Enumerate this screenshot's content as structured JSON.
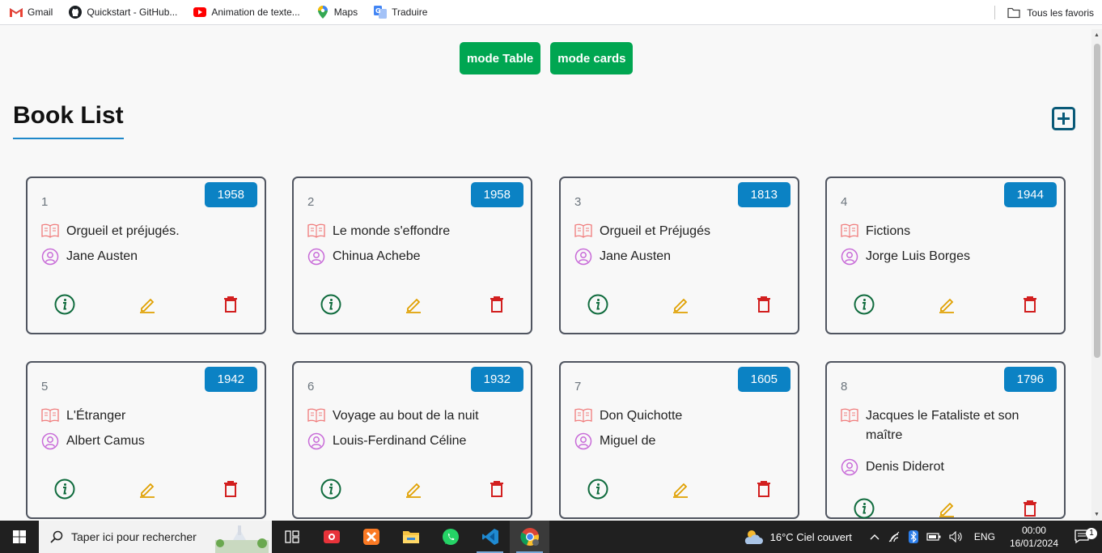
{
  "bookmarks": [
    {
      "label": "Gmail",
      "icon": "gmail-icon"
    },
    {
      "label": "Quickstart - GitHub...",
      "icon": "github-icon"
    },
    {
      "label": "Animation de texte...",
      "icon": "youtube-icon"
    },
    {
      "label": "Maps",
      "icon": "maps-icon"
    },
    {
      "label": "Traduire",
      "icon": "translate-icon"
    }
  ],
  "all_bookmarks": "Tous les favoris",
  "buttons": {
    "table": "mode Table",
    "cards": "mode cards"
  },
  "title": "Book List",
  "books": [
    {
      "id": "1",
      "year": "1958",
      "title": "Orgueil et préjugés.",
      "author": "Jane Austen"
    },
    {
      "id": "2",
      "year": "1958",
      "title": "Le monde s'effondre",
      "author": "Chinua Achebe"
    },
    {
      "id": "3",
      "year": "1813",
      "title": "Orgueil et Préjugés",
      "author": "Jane Austen"
    },
    {
      "id": "4",
      "year": "1944",
      "title": "Fictions",
      "author": "Jorge Luis Borges"
    },
    {
      "id": "5",
      "year": "1942",
      "title": "L'Étranger",
      "author": "Albert Camus"
    },
    {
      "id": "6",
      "year": "1932",
      "title": "Voyage au bout de la nuit",
      "author": "Louis-Ferdinand Céline"
    },
    {
      "id": "7",
      "year": "1605",
      "title": "Don Quichotte",
      "author": "Miguel de"
    },
    {
      "id": "8",
      "year": "1796",
      "title": "Jacques le Fataliste et son maître",
      "author": "Denis Diderot"
    }
  ],
  "colors": {
    "green": "#00a651",
    "blue": "#0b82c4",
    "info": "#0f6b3d",
    "edit": "#e0a000",
    "delete": "#d21f1f",
    "book": "#f07a7a",
    "user": "#c86bd8"
  },
  "taskbar": {
    "search_placeholder": "Taper ici pour rechercher",
    "weather": "16°C  Ciel couvert",
    "lang": "ENG",
    "time": "00:00",
    "date": "16/01/2024",
    "notifications": "1"
  }
}
